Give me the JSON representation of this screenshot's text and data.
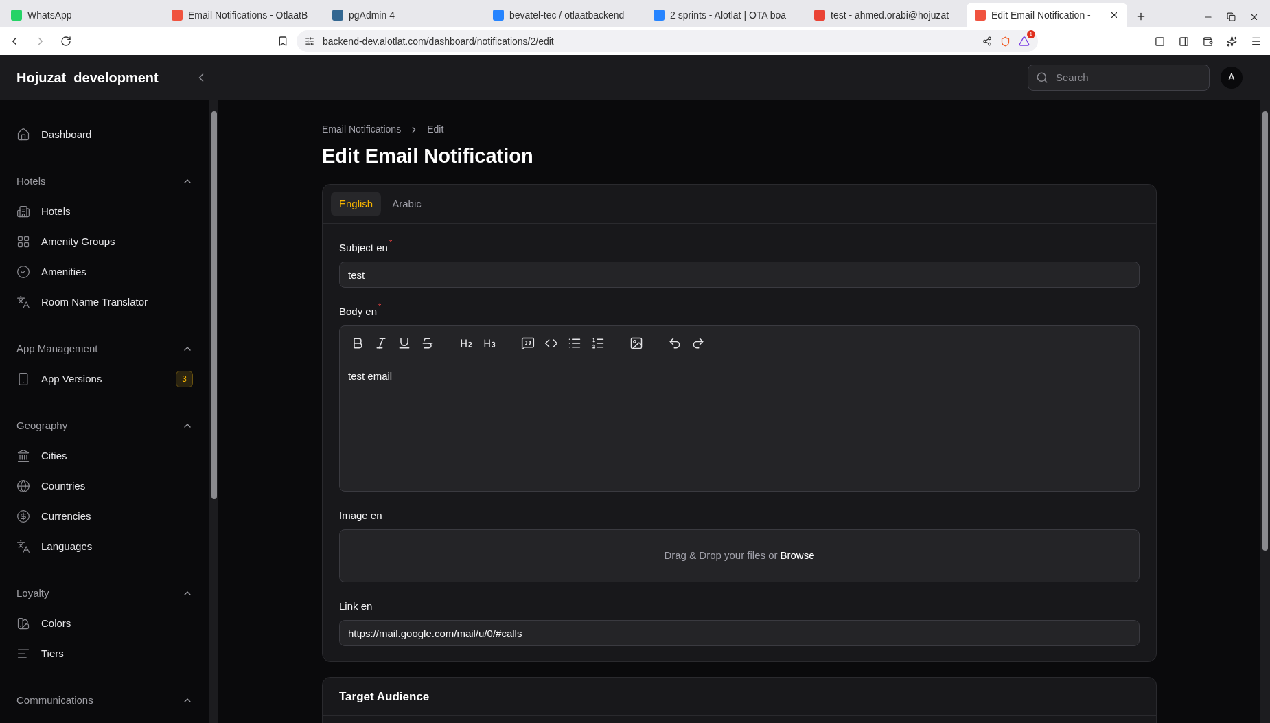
{
  "browser": {
    "tabs": [
      {
        "title": "WhatsApp",
        "selected": false
      },
      {
        "title": "Email Notifications - OtlaatB",
        "selected": false
      },
      {
        "title": "pgAdmin 4",
        "selected": false
      },
      {
        "title": "bevatel-tec / otlaatbackend",
        "selected": false
      },
      {
        "title": "2 sprints - Alotlat | OTA boa",
        "selected": false
      },
      {
        "title": "test - ahmed.orabi@hojuzat",
        "selected": false
      },
      {
        "title": "Edit Email Notification -",
        "selected": true
      }
    ],
    "url": "backend-dev.alotlat.com/dashboard/notifications/2/edit",
    "shield_count": "1"
  },
  "app": {
    "brand": "Hojuzat_development",
    "search": {
      "placeholder": "Search"
    },
    "avatar": "A"
  },
  "sidebar": {
    "items": [
      {
        "kind": "item",
        "label": "Dashboard"
      },
      {
        "kind": "group",
        "label": "Hotels",
        "expanded": true,
        "children": [
          {
            "label": "Hotels"
          },
          {
            "label": "Amenity Groups"
          },
          {
            "label": "Amenities"
          },
          {
            "label": "Room Name Translator"
          }
        ]
      },
      {
        "kind": "group",
        "label": "App Management",
        "expanded": true,
        "children": [
          {
            "label": "App Versions",
            "badge": "3"
          }
        ]
      },
      {
        "kind": "group",
        "label": "Geography",
        "expanded": true,
        "children": [
          {
            "label": "Cities"
          },
          {
            "label": "Countries"
          },
          {
            "label": "Currencies"
          },
          {
            "label": "Languages"
          }
        ]
      },
      {
        "kind": "group",
        "label": "Loyalty",
        "expanded": true,
        "children": [
          {
            "label": "Colors"
          },
          {
            "label": "Tiers"
          }
        ]
      },
      {
        "kind": "group",
        "label": "Communications",
        "expanded": true
      }
    ]
  },
  "breadcrumb": [
    "Email Notifications",
    "Edit"
  ],
  "title": "Edit Email Notification",
  "form": {
    "tabs": [
      {
        "label": "English",
        "selected": true
      },
      {
        "label": "Arabic",
        "selected": false
      }
    ],
    "fields": [
      {
        "kind": "text",
        "label": "Subject en",
        "required_mark": "*",
        "value": "test"
      },
      {
        "kind": "editor",
        "label": "Body en",
        "required_mark": "*",
        "value": "test email"
      },
      {
        "kind": "upload",
        "label": "Image en",
        "prompt": "Drag & Drop your files or",
        "action": "Browse"
      },
      {
        "kind": "text",
        "label": "Link en",
        "value": "https://mail.google.com/mail/u/0/#calls"
      }
    ]
  },
  "audience": {
    "title": "Target Audience"
  }
}
